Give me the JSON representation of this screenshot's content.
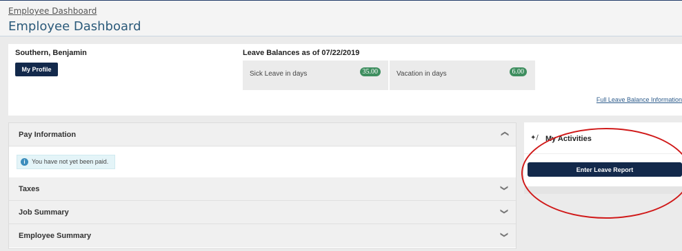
{
  "breadcrumb": {
    "label": "Employee Dashboard"
  },
  "page": {
    "title": "Employee Dashboard"
  },
  "employee": {
    "name": "Southern, Benjamin",
    "profile_button": "My Profile"
  },
  "leave_balances": {
    "heading": "Leave Balances as of 07/22/2019",
    "items": [
      {
        "label": "Sick Leave in days",
        "value": "35.00"
      },
      {
        "label": "Vacation in days",
        "value": "6.00"
      }
    ],
    "full_link": "Full Leave Balance Information"
  },
  "pay_panel": {
    "sections": [
      {
        "title": "Pay Information",
        "state": "expanded"
      },
      {
        "title": "Taxes",
        "state": "collapsed"
      },
      {
        "title": "Job Summary",
        "state": "collapsed"
      },
      {
        "title": "Employee Summary",
        "state": "collapsed"
      }
    ],
    "pay_message": "You have not yet been paid."
  },
  "activities": {
    "title": "My Activities",
    "button": "Enter Leave Report",
    "icon": "magic-wand-icon"
  },
  "colors": {
    "accent_navy": "#13294b",
    "badge_green": "#3e8e5f",
    "annotation_red": "#d01919",
    "title_blue": "#2b5a7a"
  }
}
